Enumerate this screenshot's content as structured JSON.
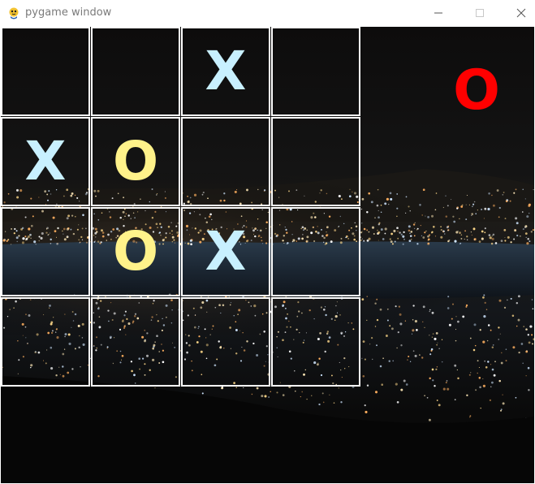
{
  "window": {
    "title": "pygame window",
    "icon": "pygame-snake-icon",
    "controls": [
      "minimize-icon",
      "maximize-icon",
      "close-icon"
    ]
  },
  "board": {
    "rows": 4,
    "cols": 4,
    "cells": [
      [
        "",
        "",
        "X",
        ""
      ],
      [
        "X",
        "O",
        "",
        ""
      ],
      [
        "",
        "O",
        "X",
        ""
      ],
      [
        "",
        "",
        "",
        ""
      ]
    ]
  },
  "turn_indicator": {
    "mark": "O",
    "color": "#ff0000"
  },
  "colors": {
    "x_mark": "#c8f0ff",
    "o_mark": "#fff28a",
    "grid_line": "#ffffff"
  }
}
